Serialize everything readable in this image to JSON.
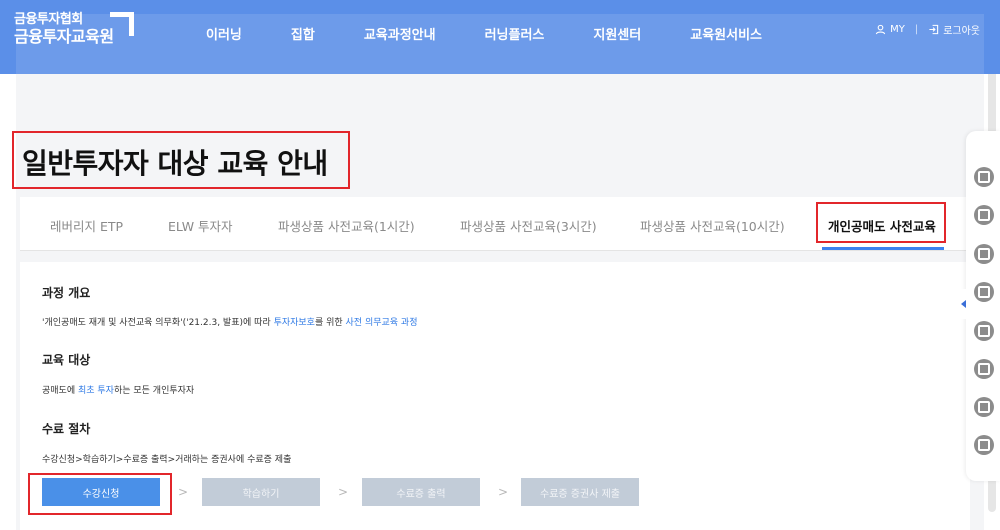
{
  "header": {
    "logo_line1": "금융투자협회",
    "logo_line2": "금융투자교육원",
    "nav": [
      "이러닝",
      "집합",
      "교육과정안내",
      "러닝플러스",
      "지원센터",
      "교육원서비스"
    ],
    "my_label": "MY",
    "logout_label": "로그아웃"
  },
  "page": {
    "title": "일반투자자 대상 교육 안내"
  },
  "tabs": [
    {
      "label": "레버리지 ETP",
      "active": false
    },
    {
      "label": "ELW 투자자",
      "active": false
    },
    {
      "label": "파생상품 사전교육(1시간)",
      "active": false
    },
    {
      "label": "파생상품 사전교육(3시간)",
      "active": false
    },
    {
      "label": "파생상품 사전교육(10시간)",
      "active": false
    },
    {
      "label": "개인공매도 사전교육",
      "active": true
    }
  ],
  "overview": {
    "title": "과정 개요",
    "text_a": "'개인공매도 재개 및 사전교육 의무화'('21.2.3, 발표)에 따라 ",
    "highlight_a": "투자자보호",
    "text_b": "를 위한 ",
    "highlight_b": "사전 의무교육 과정"
  },
  "target": {
    "title": "교육 대상",
    "text_a": "공매도에 ",
    "highlight_a": "최초 투자",
    "text_b": "하는 모든 개인투자자"
  },
  "procedure": {
    "title": "수료 절차",
    "text": "수강신청>학습하기>수료증 출력>거래하는 증권사에 수료증 제출",
    "steps": [
      "수강신청",
      "학습하기",
      "수료증 출력",
      "수료증 증권사 제출"
    ],
    "separator": ">"
  },
  "colors": {
    "header_bg": "#5b8fe8",
    "accent": "#3b82f0",
    "highlight_border": "#e2262b",
    "link": "#2f7ae5"
  },
  "icons": {
    "my": "person-icon",
    "logout": "logout-icon",
    "quick": [
      "checklist-icon",
      "basket-icon",
      "calendar-icon",
      "headset-icon",
      "search-icon",
      "user-add-icon",
      "book-icon",
      "location-icon"
    ]
  }
}
